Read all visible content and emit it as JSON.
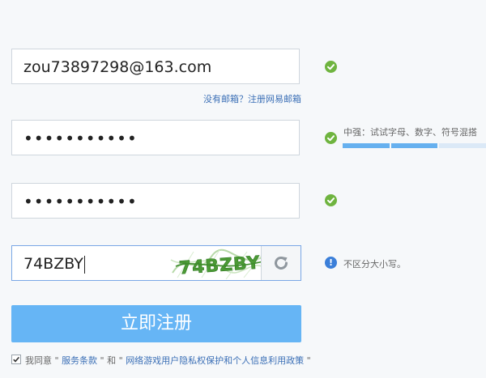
{
  "form": {
    "email": {
      "value": "zou73897298@163.com"
    },
    "no_email_link": "没有邮箱？注册网易邮箱",
    "password": {
      "value": "•••••••••••",
      "hint": "中强：试试字母、数字、符号混搭",
      "strength_segments": 3,
      "strength_filled": 2
    },
    "confirm_password": {
      "value": "•••••••••••"
    },
    "captcha": {
      "value": "74BZBY",
      "image_text": "74BZBY",
      "hint": "不区分大小写。"
    },
    "register_button": "立即注册",
    "agreement": {
      "prefix": "我同意",
      "quote_open": " \" ",
      "terms_link": "服务条款",
      "quote_close": " \" ",
      "and": "和",
      "privacy_link": "网络游戏用户隐私权保护和个人信息利用政策",
      "checked": true
    }
  },
  "colors": {
    "accent": "#66b5f5",
    "success": "#6fb43f",
    "info": "#3b7fd9",
    "link": "#3b6fb6"
  },
  "icons": {
    "valid": "check-circle-icon",
    "info": "info-circle-icon",
    "refresh": "refresh-icon"
  }
}
